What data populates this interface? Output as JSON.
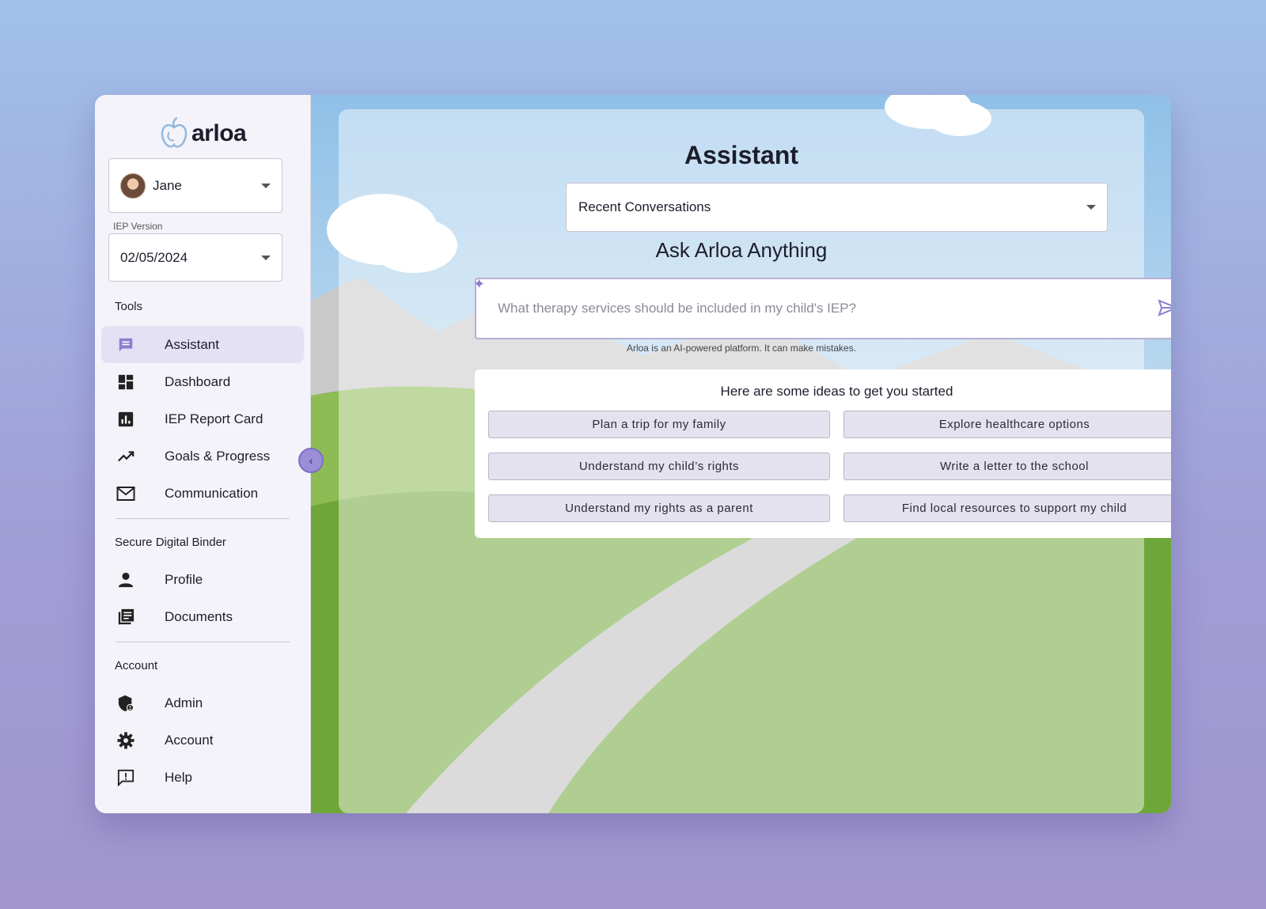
{
  "brand": {
    "name": "arloa"
  },
  "user_select": {
    "value": "Jane"
  },
  "iep": {
    "label": "IEP Version",
    "value": "02/05/2024"
  },
  "sections": {
    "tools": "Tools",
    "binder": "Secure Digital Binder",
    "account": "Account"
  },
  "nav": {
    "assistant": "Assistant",
    "dashboard": "Dashboard",
    "report_card": "IEP Report Card",
    "goals": "Goals & Progress",
    "communication": "Communication",
    "profile": "Profile",
    "documents": "Documents",
    "admin": "Admin",
    "account": "Account",
    "help": "Help"
  },
  "main": {
    "title": "Assistant",
    "recent_label": "Recent Conversations",
    "ask_title": "Ask Arloa Anything",
    "ask_placeholder": "What therapy services should be included in my child's IEP?",
    "disclaimer": "Arloa is an AI-powered platform. It can make mistakes.",
    "ideas_title": "Here are some ideas to get you started",
    "ideas": [
      "Plan a trip for my family",
      "Explore healthcare options",
      "Understand my child’s rights",
      "Write a letter to the school",
      "Understand my rights as a parent",
      "Find local resources to support my child"
    ]
  },
  "colors": {
    "accent": "#9b8ed6",
    "active_nav": "#e5e1f5",
    "sky": "#a9cdea",
    "grass": "#8bbf4f"
  }
}
